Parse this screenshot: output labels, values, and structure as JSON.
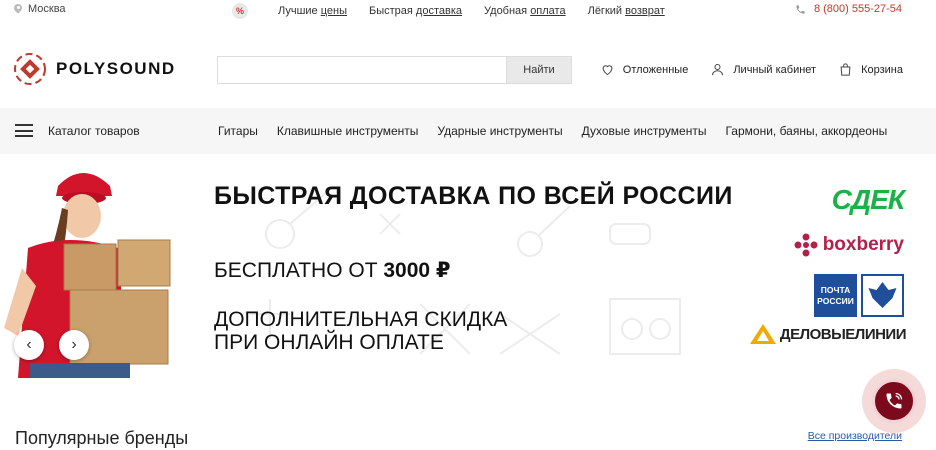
{
  "topbar": {
    "city": "Москва",
    "perks": [
      {
        "prefix": "Лучшие ",
        "link": "цены"
      },
      {
        "prefix": "Быстрая ",
        "link": "доставка"
      },
      {
        "prefix": "Удобная ",
        "link": "оплата"
      },
      {
        "prefix": "Лёгкий ",
        "link": "возврат"
      }
    ],
    "percent_icon": "%",
    "phone": "8 (800) 555-27-54"
  },
  "header": {
    "logo_text": "POLYSOUND",
    "search_placeholder": "",
    "search_button": "Найти",
    "links": {
      "wishlist": "Отложенные",
      "account": "Личный кабинет",
      "cart": "Корзина"
    }
  },
  "nav": {
    "catalog": "Каталог товаров",
    "items": [
      "Гитары",
      "Клавишные инструменты",
      "Ударные инструменты",
      "Духовые инструменты",
      "Гармони, баяны, аккордеоны"
    ]
  },
  "banner": {
    "headline": "БЫСТРАЯ ДОСТАВКА ПО ВСЕЙ РОССИИ",
    "free_prefix": "БЕСПЛАТНО ОТ ",
    "free_amount": "3000 ₽",
    "discount_line1": "ДОПОЛНИТЕЛЬНАЯ СКИДКА",
    "discount_line2": "ПРИ ОНЛАЙН ОПЛАТЕ",
    "carriers": {
      "cdek": "СДЕК",
      "boxberry": "boxberry",
      "pochta": "ПОЧТА РОССИИ",
      "dl": "ДЕЛОВЫЕЛИНИИ"
    },
    "prev_arrow": "‹",
    "next_arrow": "›"
  },
  "brands": {
    "title": "Популярные бренды",
    "all_link": "Все производители"
  },
  "colors": {
    "accent": "#c0392b",
    "call_button": "#7b0a1d",
    "cdek": "#1ab248",
    "boxberry": "#b3204a",
    "pochta": "#1f4e9b"
  },
  "icons": [
    "location-pin-icon",
    "percent-icon",
    "phone-icon",
    "heart-icon",
    "user-icon",
    "cart-icon",
    "menu-icon",
    "chevron-left-icon",
    "chevron-right-icon",
    "phone-call-icon"
  ]
}
